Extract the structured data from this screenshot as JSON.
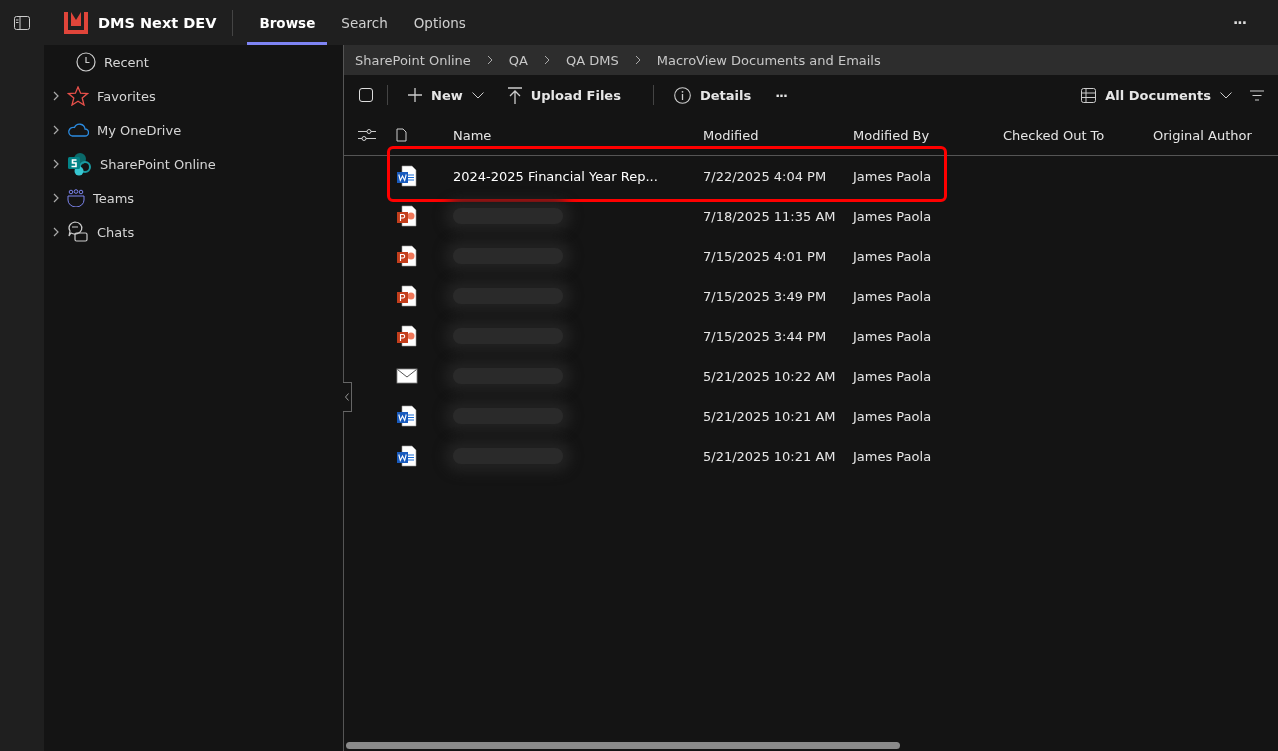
{
  "app": {
    "title": "DMS Next DEV"
  },
  "tabs": [
    {
      "label": "Browse",
      "selected": true
    },
    {
      "label": "Search",
      "selected": false
    },
    {
      "label": "Options",
      "selected": false
    }
  ],
  "more_menu": "···",
  "sidebar": {
    "items": [
      {
        "label": "Recent",
        "kind": "recent",
        "expandable": false
      },
      {
        "label": "Favorites",
        "kind": "favorites",
        "expandable": true
      },
      {
        "label": "My OneDrive",
        "kind": "onedrive",
        "expandable": true
      },
      {
        "label": "SharePoint Online",
        "kind": "sharepoint",
        "expandable": true
      },
      {
        "label": "Teams",
        "kind": "teams",
        "expandable": true
      },
      {
        "label": "Chats",
        "kind": "chats",
        "expandable": true
      }
    ]
  },
  "breadcrumb": [
    "SharePoint Online",
    "QA",
    "QA DMS",
    "MacroView Documents and Emails"
  ],
  "select_all": {
    "checked": false
  },
  "toolbar": {
    "new": "New",
    "upload": "Upload Files",
    "details": "Details",
    "more": "···",
    "view": "All Documents"
  },
  "table": {
    "columns": [
      "Name",
      "Modified",
      "Modified By",
      "Checked Out To",
      "Original Author"
    ],
    "rows": [
      {
        "kind": "word",
        "name": "2024-2025 Financial Year Rep...",
        "name_blurred": false,
        "highlighted": true,
        "modified": "7/22/2025 4:04 PM",
        "modified_by": "James Paola"
      },
      {
        "kind": "powerpoint",
        "name_blurred": true,
        "highlighted": false,
        "modified": "7/18/2025 11:35 AM",
        "modified_by": "James Paola"
      },
      {
        "kind": "powerpoint",
        "name_blurred": true,
        "highlighted": false,
        "modified": "7/15/2025 4:01 PM",
        "modified_by": "James Paola"
      },
      {
        "kind": "powerpoint",
        "name_blurred": true,
        "highlighted": false,
        "modified": "7/15/2025 3:49 PM",
        "modified_by": "James Paola"
      },
      {
        "kind": "powerpoint",
        "name_blurred": true,
        "highlighted": false,
        "modified": "7/15/2025 3:44 PM",
        "modified_by": "James Paola"
      },
      {
        "kind": "email",
        "name_blurred": true,
        "highlighted": false,
        "modified": "5/21/2025 10:22 AM",
        "modified_by": "James Paola"
      },
      {
        "kind": "word",
        "name_blurred": true,
        "highlighted": false,
        "modified": "5/21/2025 10:21 AM",
        "modified_by": "James Paola"
      },
      {
        "kind": "word",
        "name_blurred": true,
        "highlighted": false,
        "modified": "5/21/2025 10:21 AM",
        "modified_by": "James Paola"
      }
    ]
  }
}
